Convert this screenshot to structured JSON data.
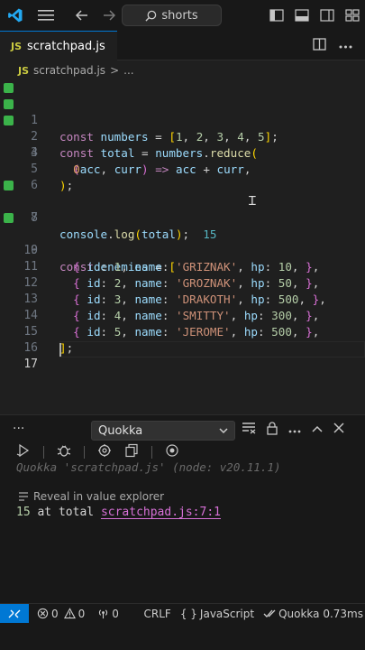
{
  "titlebar": {
    "search_text": "shorts",
    "icons": [
      "vscode-logo-icon",
      "menu-icon",
      "back-arrow-icon",
      "forward-arrow-icon",
      "search-icon",
      "toggle-sidebar-icon",
      "toggle-panel-icon",
      "toggle-secondary-sidebar-icon",
      "customize-layout-icon"
    ]
  },
  "tab": {
    "badge": "JS",
    "filename": "scratchpad.js"
  },
  "breadcrumb": {
    "badge": "JS",
    "file": "scratchpad.js",
    "separator": ">",
    "symbol": "..."
  },
  "editor": {
    "line_numbers": [
      "1",
      "2",
      "3",
      "4",
      "5",
      "6",
      "7",
      "8",
      "9",
      "10",
      "11",
      "12",
      "13",
      "14",
      "15",
      "16",
      "17"
    ],
    "inline_result": "15",
    "enemies": [
      {
        "id": "1",
        "name": "'GRIZNAK'",
        "hp": "10"
      },
      {
        "id": "2",
        "name": "'GROZNAK'",
        "hp": "50"
      },
      {
        "id": "3",
        "name": "'DRAKOTH'",
        "hp": "500"
      },
      {
        "id": "4",
        "name": "'SMITTY'",
        "hp": "300"
      },
      {
        "id": "5",
        "name": "'JEROME'",
        "hp": "500"
      }
    ]
  },
  "panel": {
    "more": "···",
    "selected_output": "Quokka",
    "status_line": "Quokka 'scratchpad.js' (node: v20.11.1)",
    "reveal_label": "Reveal in value explorer",
    "result_value": "15",
    "result_text": "at total",
    "result_link": "scratchpad.js:7:1"
  },
  "statusbar": {
    "errors": "0",
    "warnings": "0",
    "ports": "0",
    "eol": "CRLF",
    "language_braces": "{ }",
    "language": "JavaScript",
    "quokka": "Quokka 0.73ms"
  },
  "colors": {
    "accent": "#0078d4",
    "gutter_added": "#3bb34a",
    "keyword": "#c586c0",
    "variable": "#9cdcfe",
    "function": "#dcdcaa",
    "number": "#b5cea8",
    "string": "#ce9178",
    "inline_result": "#56b6c2"
  }
}
